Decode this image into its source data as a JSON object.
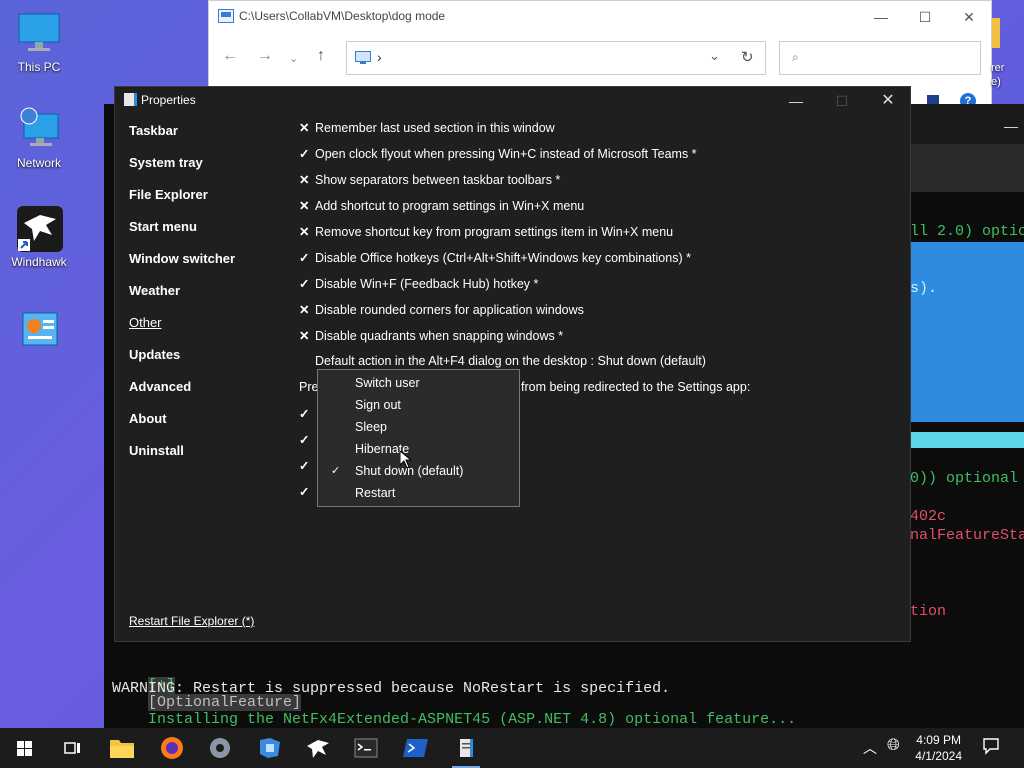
{
  "desktop": {
    "icons": [
      {
        "label": "This PC"
      },
      {
        "label": "Network"
      },
      {
        "label": "Windhawk"
      },
      {
        "label": ""
      }
    ]
  },
  "explorer": {
    "title": "C:\\Users\\CollabVM\\Desktop\\dog mode",
    "address_chevron": "›",
    "partial_right_text": "rer",
    "partial_right_text2": "e)"
  },
  "terminal": {
    "lines": [
      {
        "text": "ll 2.0) optic",
        "color": "#3fbf5f"
      },
      {
        "text": "s).",
        "color": "#7fd1e8"
      },
      {
        "text": "0)) optional",
        "color": "#3fbf5f"
      },
      {
        "text": "402c",
        "color": "#e0506a"
      },
      {
        "text": "nalFeatureSta",
        "color": "#e0506a"
      },
      {
        "text": "tion",
        "color": "#e0506a"
      }
    ],
    "bottom_line1_prefix": "[+]",
    "bottom_line1_tag": "[OptionalFeature]",
    "bottom_line1_text": "Installing the NetFx4Extended-ASPNET45 (ASP.NET 4.8) optional feature...",
    "bottom_line2": "WARNING: Restart is suppressed because NoRestart is specified."
  },
  "properties": {
    "title": "Properties",
    "nav": [
      {
        "label": "Taskbar",
        "current": false
      },
      {
        "label": "System tray",
        "current": false
      },
      {
        "label": "File Explorer",
        "current": false
      },
      {
        "label": "Start menu",
        "current": false
      },
      {
        "label": "Window switcher",
        "current": false
      },
      {
        "label": "Weather",
        "current": false
      },
      {
        "label": "Other",
        "current": true
      },
      {
        "label": "Updates",
        "current": false
      },
      {
        "label": "Advanced",
        "current": false
      },
      {
        "label": "About",
        "current": false
      },
      {
        "label": "Uninstall",
        "current": false
      }
    ],
    "options": [
      {
        "mark": "✕",
        "label": "Remember last used section in this window"
      },
      {
        "mark": "✓",
        "label": "Open clock flyout when pressing Win+C instead of Microsoft Teams *"
      },
      {
        "mark": "✕",
        "label": "Show separators between taskbar toolbars *"
      },
      {
        "mark": "✕",
        "label": "Add shortcut to program settings in Win+X menu"
      },
      {
        "mark": "✕",
        "label": "Remove shortcut key from program settings item in Win+X menu"
      },
      {
        "mark": "✓",
        "label": "Disable Office hotkeys (Ctrl+Alt+Shift+Windows key combinations) *"
      },
      {
        "mark": "✓",
        "label": "Disable Win+F (Feedback Hub) hotkey *"
      },
      {
        "mark": "✕",
        "label": "Disable rounded corners for application windows"
      },
      {
        "mark": "✕",
        "label": "Disable quadrants when snapping windows *"
      },
      {
        "mark": "",
        "label": "Default action in the Alt+F4 dialog on the desktop : Shut down (default)"
      }
    ],
    "partial_prefix": "Pre",
    "partial_suffix": "from being redirected to the Settings app:",
    "hidden_checks": [
      "✓",
      "✓",
      "✓",
      "✓"
    ],
    "restart_link": "Restart File Explorer (*)"
  },
  "menu": {
    "items": [
      {
        "label": "Switch user",
        "checked": ""
      },
      {
        "label": "Sign out",
        "checked": ""
      },
      {
        "label": "Sleep",
        "checked": ""
      },
      {
        "label": "Hibernate",
        "checked": ""
      },
      {
        "label": "Shut down (default)",
        "checked": "✓"
      },
      {
        "label": "Restart",
        "checked": ""
      }
    ]
  },
  "taskbar": {
    "time": "4:09 PM",
    "date": "4/1/2024"
  },
  "colors": {
    "desktop": "#5a64d8",
    "window_bg": "#1f1f1f",
    "menu_bg": "#2b2b2b",
    "terminal_green": "#3fbf5f",
    "terminal_red": "#e0506a"
  }
}
